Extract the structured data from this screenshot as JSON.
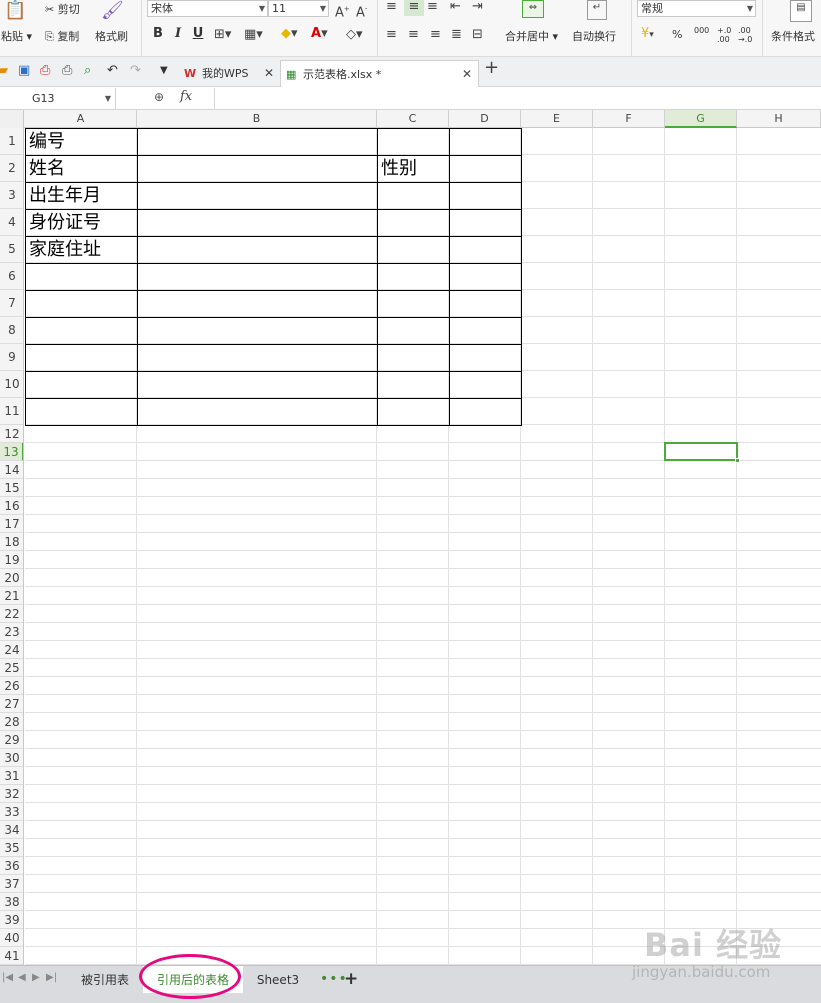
{
  "ribbon": {
    "paste": "粘贴",
    "cut": "剪切",
    "copy": "复制",
    "format_painter": "格式刷",
    "font_name": "宋体",
    "font_size": "11",
    "merge_center": "合并居中",
    "wrap_text": "自动换行",
    "number_format": "常规",
    "percent": "%",
    "comma": "000",
    "dec_inc": "+.0\n.00",
    "dec_dec": ".00\n→.0",
    "conditional_format": "条件格式"
  },
  "tabs": {
    "home": "我的WPS",
    "doc": "示范表格.xlsx *"
  },
  "formula_bar": {
    "name_box": "G13",
    "fx": "fx",
    "value": ""
  },
  "columns": [
    "A",
    "B",
    "C",
    "D",
    "E",
    "F",
    "G",
    "H"
  ],
  "rows": [
    "1",
    "2",
    "3",
    "4",
    "5",
    "6",
    "7",
    "8",
    "9",
    "10",
    "11",
    "12",
    "13",
    "14",
    "15",
    "16",
    "17",
    "18",
    "19",
    "20",
    "21",
    "22",
    "23",
    "24",
    "25",
    "26",
    "27",
    "28",
    "29",
    "30",
    "31",
    "32",
    "33",
    "34",
    "35",
    "36",
    "37",
    "38",
    "39",
    "40",
    "41"
  ],
  "table": {
    "r1": {
      "a": "编号",
      "b": "",
      "c": "",
      "d": ""
    },
    "r2": {
      "a": "姓名",
      "b": "",
      "c": "性别",
      "d": ""
    },
    "r3": {
      "a": "出生年月",
      "b": "",
      "c": "",
      "d": ""
    },
    "r4": {
      "a": "身份证号",
      "b": "",
      "c": "",
      "d": ""
    },
    "r5": {
      "a": "家庭住址",
      "b": "",
      "c": "",
      "d": ""
    }
  },
  "sheets": {
    "sheet1": "被引用表",
    "sheet2": "引用后的表格",
    "sheet3": "Sheet3"
  },
  "watermark": {
    "brand": "Bai 经验",
    "url": "jingyan.baidu.com"
  },
  "colors": {
    "accent_green": "#4caa3a",
    "annotation_pink": "#e6087e"
  }
}
